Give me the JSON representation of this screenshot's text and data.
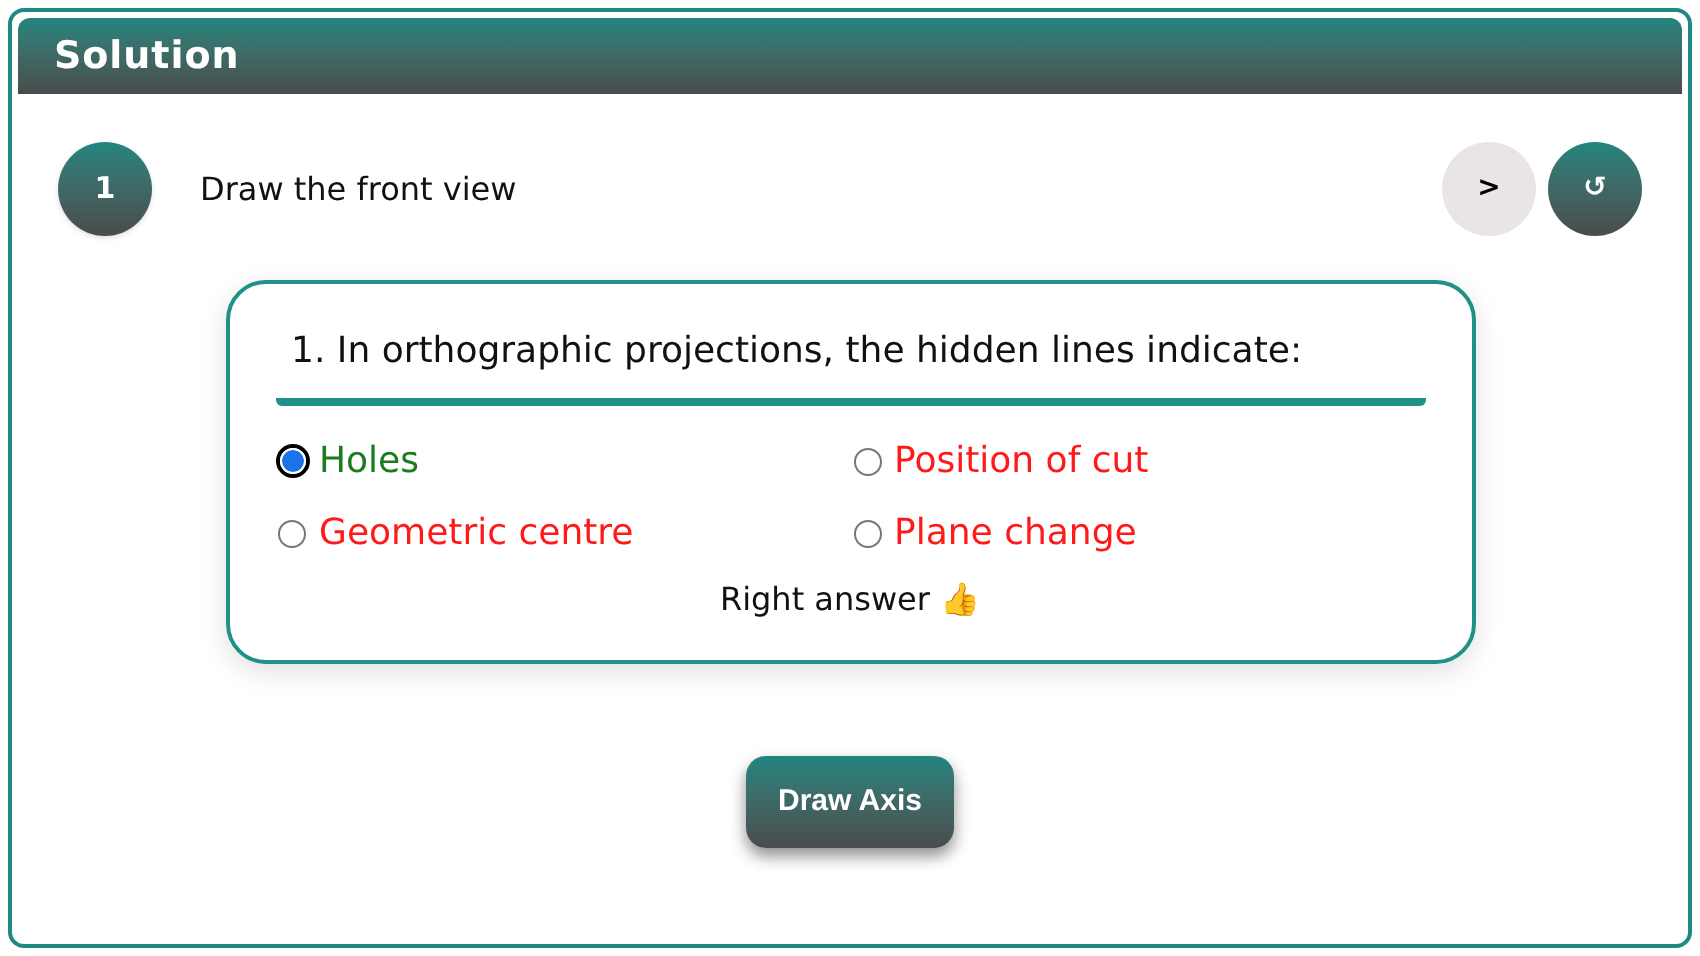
{
  "panel": {
    "title": "Solution"
  },
  "step": {
    "number": "1",
    "text": "Draw the front view"
  },
  "controls": [
    {
      "kind": "next",
      "label": ">"
    },
    {
      "kind": "reset",
      "label": "↺"
    }
  ],
  "question": {
    "text": "1. In orthographic projections, the hidden lines indicate:",
    "options": [
      {
        "label": "Holes",
        "selected": true,
        "correct": true
      },
      {
        "label": "Position of cut",
        "selected": false,
        "correct": false
      },
      {
        "label": "Geometric centre",
        "selected": false,
        "correct": false
      },
      {
        "label": "Plane change",
        "selected": false,
        "correct": false
      }
    ],
    "feedback": "Right answer 👍"
  },
  "action_button": "Draw Axis"
}
